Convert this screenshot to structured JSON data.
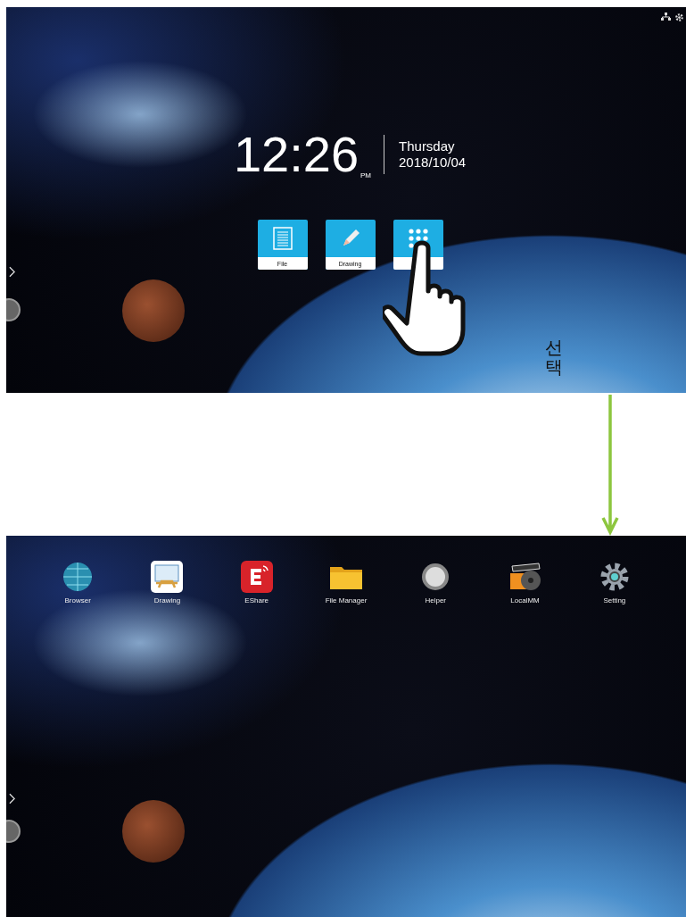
{
  "top_screen": {
    "clock": {
      "time": "12:26",
      "ampm": "PM",
      "day": "Thursday",
      "date": "2018/10/04"
    },
    "shortcuts": [
      {
        "kind": "file",
        "label": "File"
      },
      {
        "kind": "drawing",
        "label": "Drawing"
      },
      {
        "kind": "apps"
      }
    ],
    "annotation": "선택"
  },
  "bottom_screen": {
    "apps": [
      {
        "kind": "browser",
        "label": "Browser"
      },
      {
        "kind": "drawing",
        "label": "Drawing"
      },
      {
        "kind": "eshare",
        "label": "EShare"
      },
      {
        "kind": "folder",
        "label": "File Manager"
      },
      {
        "kind": "helper",
        "label": "Helper"
      },
      {
        "kind": "media",
        "label": "LocalMM"
      },
      {
        "kind": "setting",
        "label": "Setting"
      }
    ]
  }
}
